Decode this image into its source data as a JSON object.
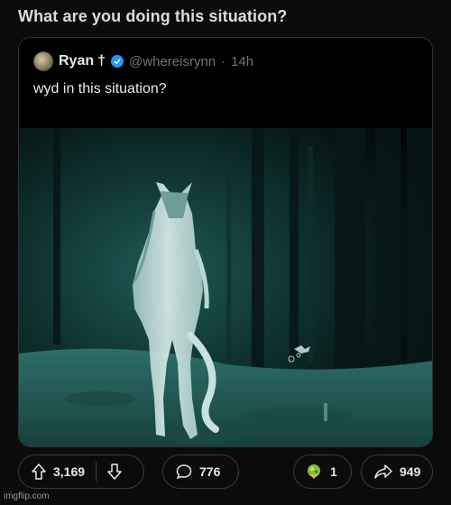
{
  "post": {
    "title": "What are you doing this situation?"
  },
  "tweet": {
    "display_name": "Ryan",
    "name_suffix": "†",
    "handle": "@whereisrynn",
    "separator": "·",
    "time": "14h",
    "text": "wyd in this situation?",
    "verified": true
  },
  "actions": {
    "upvotes": "3,169",
    "comments": "776",
    "awards": "1",
    "shares": "949"
  },
  "icons": {
    "upvote": "arrow-up-icon",
    "downvote": "arrow-down-icon",
    "comment": "speech-bubble-icon",
    "award": "award-icon",
    "share": "share-arrow-icon",
    "verified": "verified-badge-icon"
  },
  "watermark": "imgflip.com",
  "colors": {
    "verified_blue": "#1d9bf0",
    "night_vision_teal": "#3f8f88"
  }
}
